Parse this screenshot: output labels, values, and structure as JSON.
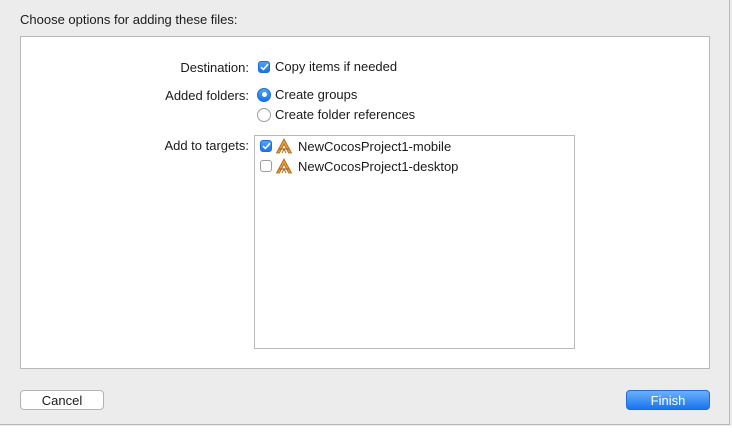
{
  "dialog": {
    "heading": "Choose options for adding these files:",
    "destination": {
      "label": "Destination:",
      "copy_items": {
        "label": "Copy items if needed",
        "checked": true
      }
    },
    "added_folders": {
      "label": "Added folders:",
      "options": [
        {
          "label": "Create groups",
          "selected": true
        },
        {
          "label": "Create folder references",
          "selected": false
        }
      ]
    },
    "targets": {
      "label": "Add to targets:",
      "items": [
        {
          "name": "NewCocosProject1-mobile",
          "checked": true,
          "icon": "xcode-app-target-icon"
        },
        {
          "name": "NewCocosProject1-desktop",
          "checked": false,
          "icon": "xcode-app-target-icon"
        }
      ]
    },
    "buttons": {
      "cancel": "Cancel",
      "finish": "Finish"
    }
  },
  "colors": {
    "accent": "#1a73e8",
    "panel_bg": "#ffffff",
    "window_bg": "#ececec"
  }
}
